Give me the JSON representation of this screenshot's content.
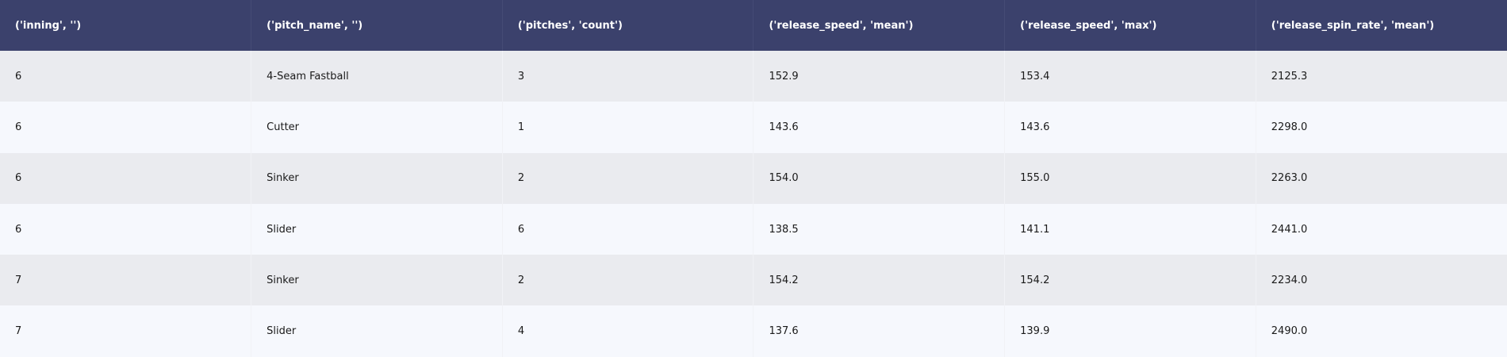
{
  "table": {
    "headers": [
      "('inning', '')",
      "('pitch_name', '')",
      "('pitches', 'count')",
      "('release_speed', 'mean')",
      "('release_speed', 'max')",
      "('release_spin_rate', 'mean')"
    ],
    "rows": [
      [
        "6",
        "4-Seam Fastball",
        "3",
        "152.9",
        "153.4",
        "2125.3"
      ],
      [
        "6",
        "Cutter",
        "1",
        "143.6",
        "143.6",
        "2298.0"
      ],
      [
        "6",
        "Sinker",
        "2",
        "154.0",
        "155.0",
        "2263.0"
      ],
      [
        "6",
        "Slider",
        "6",
        "138.5",
        "141.1",
        "2441.0"
      ],
      [
        "7",
        "Sinker",
        "2",
        "154.2",
        "154.2",
        "2234.0"
      ],
      [
        "7",
        "Slider",
        "4",
        "137.6",
        "139.9",
        "2490.0"
      ]
    ]
  },
  "colors": {
    "header_background": "#3b416c",
    "header_text": "#ffffff",
    "row_odd": "#eaebef",
    "row_even": "#f6f8fd"
  }
}
